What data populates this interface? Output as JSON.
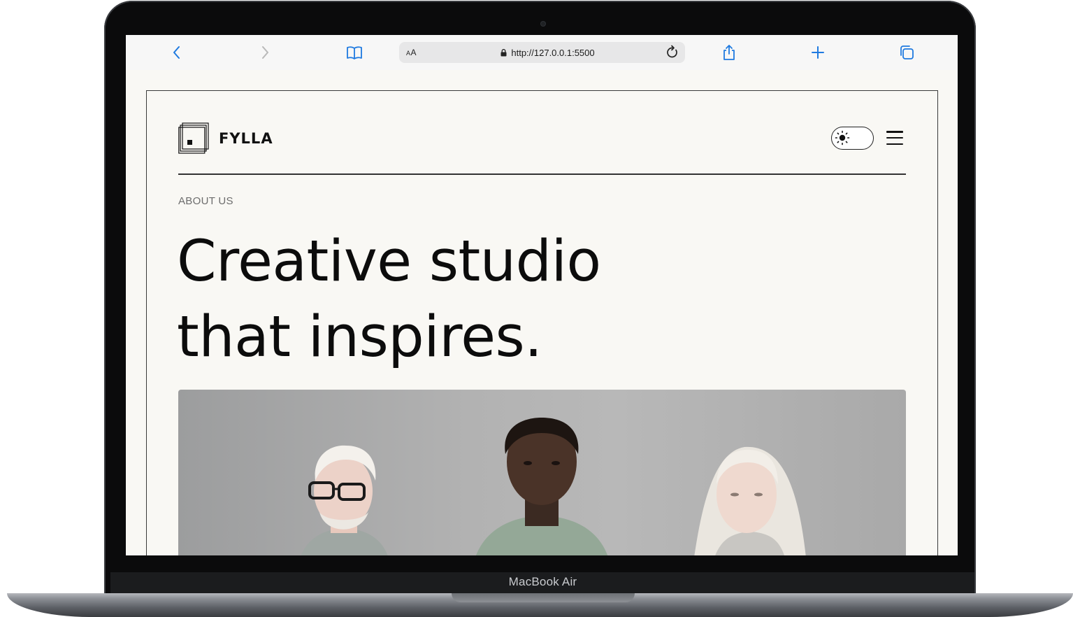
{
  "device": {
    "label": "MacBook Air"
  },
  "browser": {
    "url": "http://127.0.0.1:5500",
    "reader_label": "AA",
    "icons": [
      "back-icon",
      "forward-icon",
      "bookmarks-icon",
      "lock-icon",
      "reload-icon",
      "share-icon",
      "new-tab-icon",
      "tabs-icon"
    ]
  },
  "header": {
    "brand": "FYLLA",
    "theme_toggle": {
      "state": "light",
      "icon": "sun-icon"
    },
    "menu_icon": "hamburger-icon"
  },
  "hero": {
    "eyebrow": "ABOUT US",
    "headline_line1": "Creative studio",
    "headline_line2": "that inspires.",
    "image_subject": "three people portrait"
  },
  "colors": {
    "page_bg": "#f9f8f4",
    "text": "#0c0c0c",
    "eyebrow": "#6d6d6d",
    "toolbar_bg": "#f7f7f7",
    "accent_blue": "#1f7ae0"
  }
}
